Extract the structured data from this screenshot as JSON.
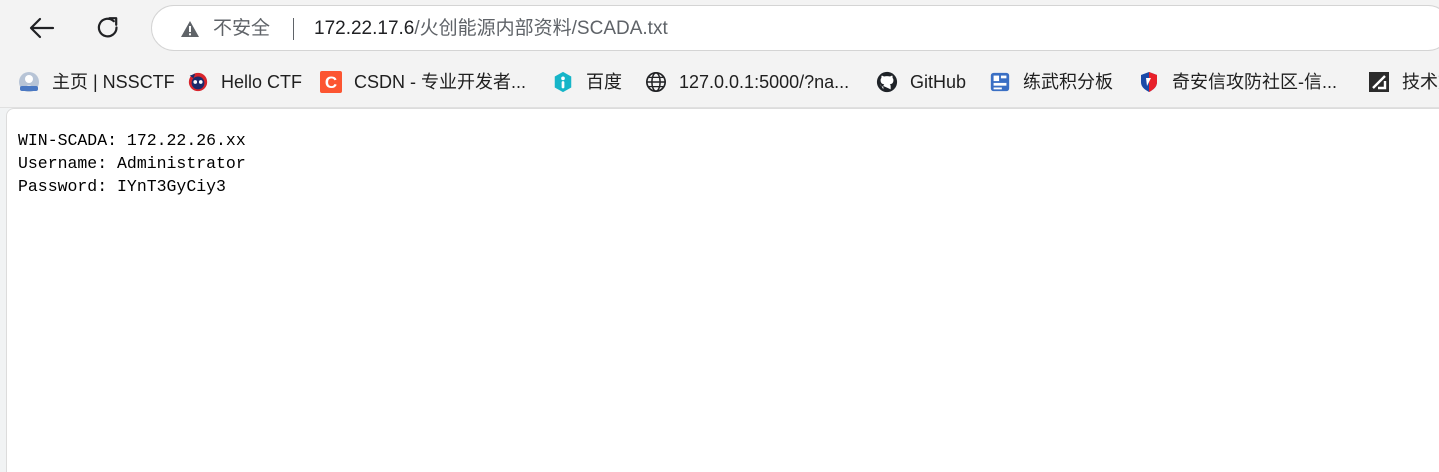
{
  "toolbar": {
    "back_icon": "arrow-left-icon",
    "reload_icon": "reload-icon",
    "security_icon": "warning-triangle-icon",
    "security_text": "不安全",
    "url_host": "172.22.17.6",
    "url_path": "/火创能源内部资料/SCADA.txt"
  },
  "bookmarks": [
    {
      "label": "主页 | NSSCTF",
      "icon": "nssctf-icon"
    },
    {
      "label": "Hello CTF",
      "icon": "hello-ctf-icon"
    },
    {
      "label": "CSDN - 专业开发者...",
      "icon": "csdn-icon"
    },
    {
      "label": "百度",
      "icon": "baidu-icon"
    },
    {
      "label": "127.0.0.1:5000/?na...",
      "icon": "globe-icon"
    },
    {
      "label": "GitHub",
      "icon": "github-icon"
    },
    {
      "label": "练武积分板",
      "icon": "scoreboard-icon"
    },
    {
      "label": "奇安信攻防社区-信...",
      "icon": "qianxin-icon"
    },
    {
      "label": "技术文",
      "icon": "tech-icon"
    }
  ],
  "document": {
    "lines": [
      "WIN-SCADA: 172.22.26.xx",
      "Username: Administrator",
      "Password: IYnT3GyCiy3"
    ]
  },
  "colors": {
    "csdn": "#fc5531",
    "baidu": "#16b5c8",
    "qianxin_red": "#e8202a",
    "qianxin_blue": "#1a4aa8",
    "hello_ctf_red": "#d8242c"
  }
}
